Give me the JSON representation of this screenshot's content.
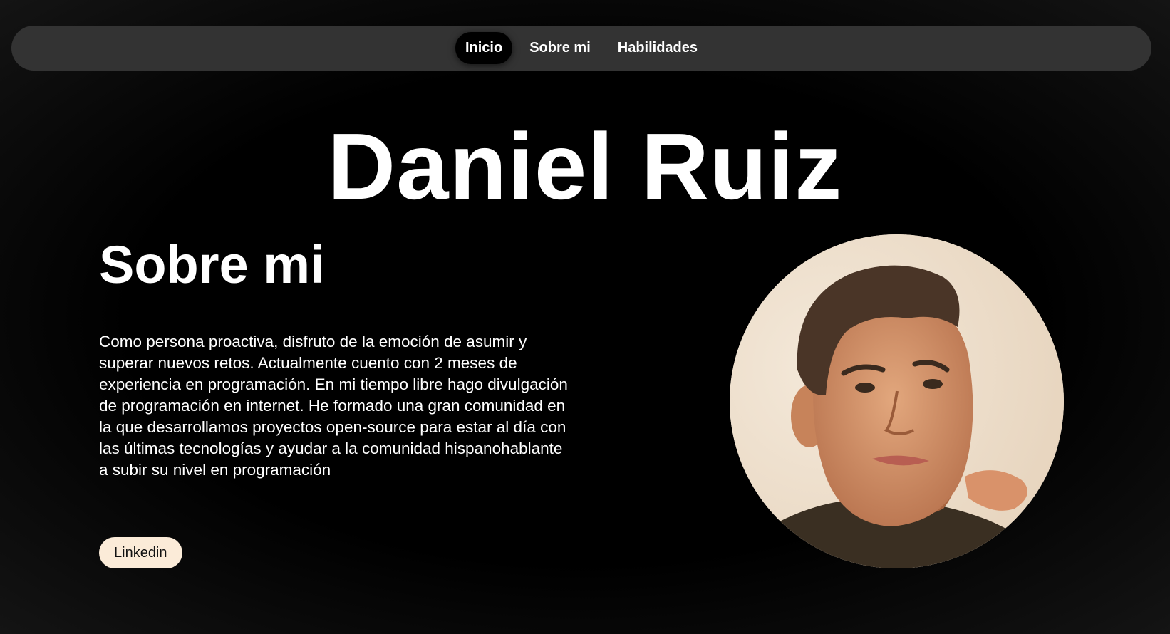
{
  "nav": {
    "items": [
      {
        "label": "Inicio",
        "active": true
      },
      {
        "label": "Sobre mi",
        "active": false
      },
      {
        "label": "Habilidades",
        "active": false
      }
    ]
  },
  "hero": {
    "name": "Daniel Ruiz"
  },
  "about": {
    "title": "Sobre mi",
    "text": "Como persona proactiva, disfruto de la emoción de asumir y superar nuevos retos. Actualmente cuento con 2 meses de experiencia en programación. En mi tiempo libre hago divulgación de programación en internet. He formado una gran comunidad en la que desarrollamos proyectos open-source para estar al día con las últimas tecnologías y ayudar a la comunidad hispanohablante a subir su nivel en programación",
    "linkedin_label": "Linkedin"
  },
  "colors": {
    "background": "#000000",
    "navbar": "#333333",
    "button": "#fbebd8",
    "text": "#ffffff"
  }
}
